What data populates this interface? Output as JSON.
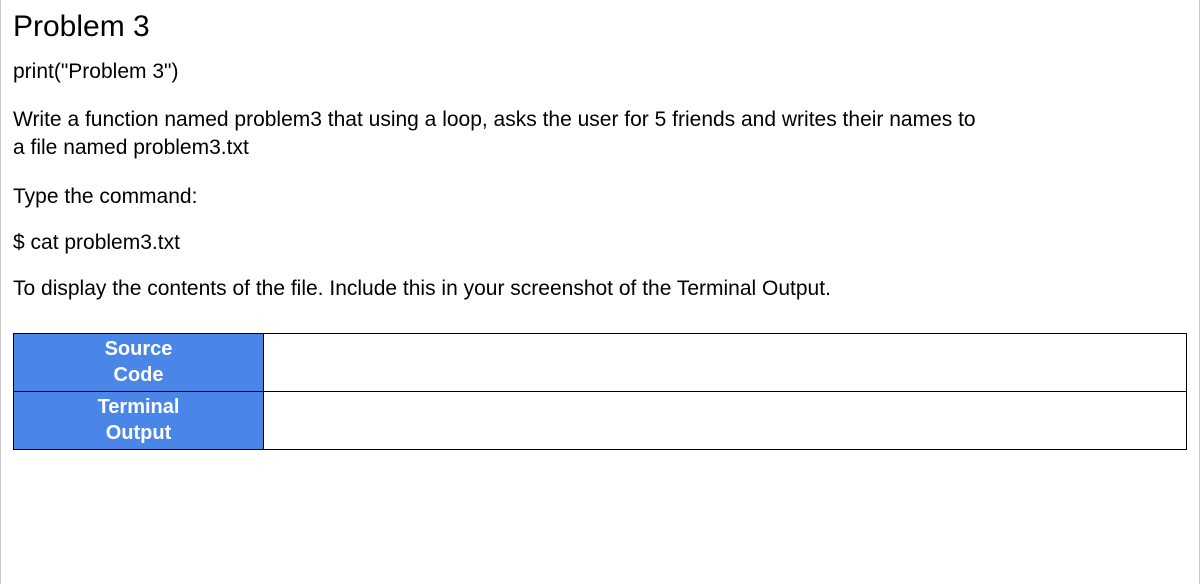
{
  "title": "Problem 3",
  "codeLine": "print(\"Problem 3\")",
  "description": "Write a function named problem3 that using a loop, asks the user for 5 friends and writes their names to a file named problem3.txt",
  "typeCommandLabel": "Type the command:",
  "command": "$ cat problem3.txt",
  "displayNote": "To display the contents of the file.  Include this in your screenshot of the Terminal Output.",
  "table": {
    "row1": {
      "labelLine1": "Source",
      "labelLine2": "Code",
      "content": ""
    },
    "row2": {
      "labelLine1": "Terminal",
      "labelLine2": "Output",
      "content": ""
    }
  }
}
